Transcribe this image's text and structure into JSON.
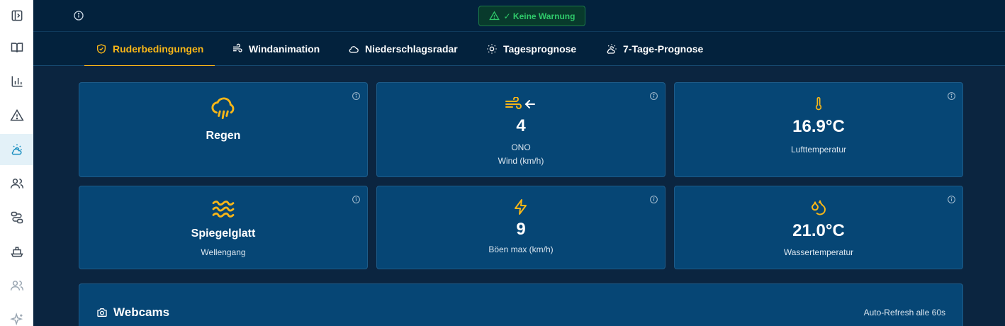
{
  "sidebar": {
    "items": [
      {
        "icon": "panel-toggle-icon",
        "active": false
      },
      {
        "icon": "book-icon",
        "active": false
      },
      {
        "icon": "bar-chart-icon",
        "active": false
      },
      {
        "icon": "warning-icon",
        "active": false
      },
      {
        "icon": "weather-icon",
        "active": true
      },
      {
        "icon": "users-icon",
        "active": false
      },
      {
        "icon": "route-icon",
        "active": false
      },
      {
        "icon": "boat-icon",
        "active": false
      },
      {
        "icon": "group-icon",
        "active": false
      },
      {
        "icon": "sparkles-icon",
        "active": false
      }
    ]
  },
  "topbar": {
    "warning_label": "✓ Keine Warnung"
  },
  "tabs": [
    {
      "label": "Ruderbedingungen",
      "icon": "shield-check-icon",
      "active": true
    },
    {
      "label": "Windanimation",
      "icon": "wind-icon",
      "active": false
    },
    {
      "label": "Niederschlagsradar",
      "icon": "cloud-icon",
      "active": false
    },
    {
      "label": "Tagesprognose",
      "icon": "sun-icon",
      "active": false
    },
    {
      "label": "7-Tage-Prognose",
      "icon": "cloud-sun-icon",
      "active": false
    }
  ],
  "cards": {
    "weather": {
      "value": "Regen",
      "icon": "rain-cloud-icon"
    },
    "wind": {
      "value": "4",
      "direction": "ONO",
      "label": "Wind (km/h)",
      "icon": "wind-icon"
    },
    "air_temp": {
      "value": "16.9°C",
      "label": "Lufttemperatur",
      "icon": "thermometer-icon"
    },
    "waves": {
      "value": "Spiegelglatt",
      "label": "Wellengang",
      "icon": "waves-icon"
    },
    "gusts": {
      "value": "9",
      "label": "Böen max (km/h)",
      "icon": "lightning-icon"
    },
    "water_temp": {
      "value": "21.0°C",
      "label": "Wassertemperatur",
      "icon": "droplets-icon"
    }
  },
  "webcams": {
    "title": "Webcams",
    "refresh": "Auto-Refresh alle 60s"
  },
  "colors": {
    "accent": "#f7b618",
    "success": "#2fc96a",
    "card_bg": "#064675",
    "page_bg": "#0b2540"
  }
}
